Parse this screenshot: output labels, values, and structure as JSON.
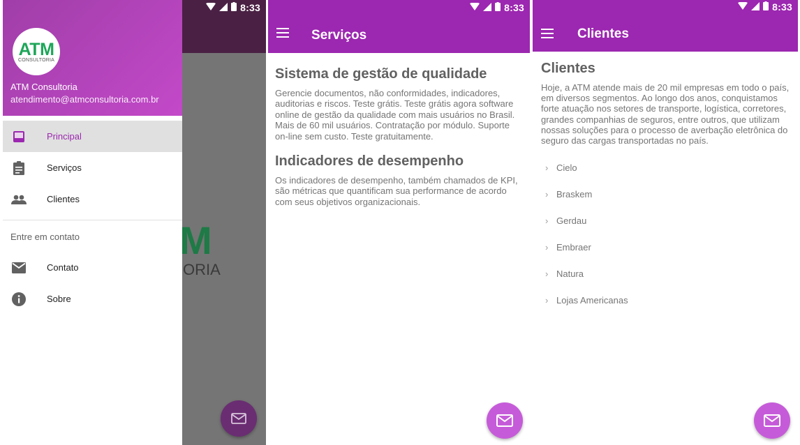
{
  "status": {
    "time": "8:33"
  },
  "drawer": {
    "logo_text": "ATM",
    "logo_sub": "CONSULTORIA",
    "name": "ATM Consultoria",
    "email": "atendimento@atmconsultoria.com.br",
    "items": [
      {
        "label": "Principal",
        "icon": "inbox-icon",
        "active": true
      },
      {
        "label": "Serviços",
        "icon": "clipboard-icon"
      },
      {
        "label": "Clientes",
        "icon": "people-icon"
      }
    ],
    "section_label": "Entre em contato",
    "contact_items": [
      {
        "label": "Contato",
        "icon": "mail-icon"
      },
      {
        "label": "Sobre",
        "icon": "info-icon"
      }
    ],
    "background_logo_main": "M",
    "background_logo_sub": "ORIA"
  },
  "servicos": {
    "title": "Serviços",
    "sections": [
      {
        "heading": "Sistema de gestão de qualidade",
        "text": "Gerencie documentos, não conformidades, indicadores, auditorias e riscos. Teste grátis. Teste grátis agora software online de gestão da qualidade com mais usuários no Brasil. Mais de 60 mil usuários. Contratação por módulo. Suporte on-line sem custo. Teste gratuitamente."
      },
      {
        "heading": "Indicadores de desempenho",
        "text": "Os indicadores de desempenho, também chamados de KPI, são métricas que quantificam sua performance de acordo com seus objetivos organizacionais."
      }
    ]
  },
  "clientes": {
    "title": "Clientes",
    "heading": "Clientes",
    "text": "Hoje, a ATM atende mais de 20 mil empresas em todo o país, em diversos segmentos. Ao longo dos anos, conquistamos forte atuação nos setores de transporte, logística, corretores, grandes companhias de seguros, entre outros, que utilizam nossas soluções para o processo de averbação eletrônica do seguro das cargas transportadas no país.",
    "list": [
      "Cielo",
      "Braskem",
      "Gerdau",
      "Embraer",
      "Natura",
      "Lojas Americanas"
    ]
  },
  "colors": {
    "primary": "#9c27b0",
    "fab": "#c65bd9",
    "logo_green": "#1ea65a"
  }
}
